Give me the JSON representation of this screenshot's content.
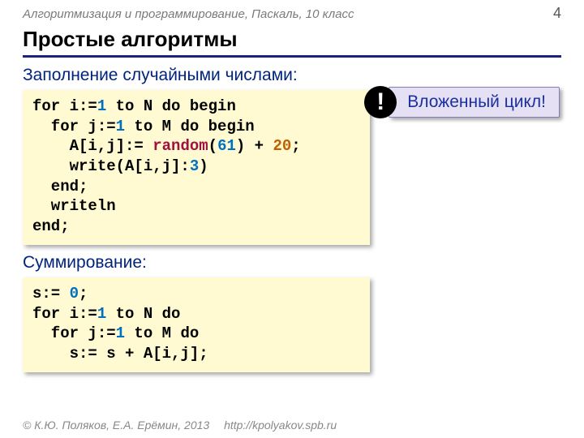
{
  "header": {
    "course": "Алгоритмизация и программирование, Паскаль, 10 класс",
    "page": "4"
  },
  "title": "Простые алгоритмы",
  "section1": {
    "heading": "Заполнение случайными числами:"
  },
  "section2": {
    "heading": "Суммирование:"
  },
  "callout": {
    "mark": "!",
    "text": "Вложенный цикл!"
  },
  "code1": {
    "l1a": "for i:=",
    "l1n": "1",
    "l1b": " to N do begin",
    "l2a": "  for j:=",
    "l2n": "1",
    "l2b": " to M do begin",
    "l3a": "    A[i,j]:= ",
    "l3fn": "random",
    "l3p1": "(",
    "l3arg": "61",
    "l3p2": ") + ",
    "l3c": "20",
    "l3e": ";",
    "l4": "    write(A[i,j]:",
    "l4n": "3",
    "l4e": ")",
    "l5": "  end;",
    "l6": "  writeln",
    "l7": "end;"
  },
  "code2": {
    "l1a": "s:= ",
    "l1n": "0",
    "l1e": ";",
    "l2a": "for i:=",
    "l2n": "1",
    "l2b": " to N do",
    "l3a": "  for j:=",
    "l3n": "1",
    "l3b": " to M do",
    "l4": "    s:= s + A[i,j];"
  },
  "footer": {
    "copy": "© К.Ю. Поляков, Е.А. Ерёмин, 2013",
    "url": "http://kpolyakov.spb.ru"
  }
}
